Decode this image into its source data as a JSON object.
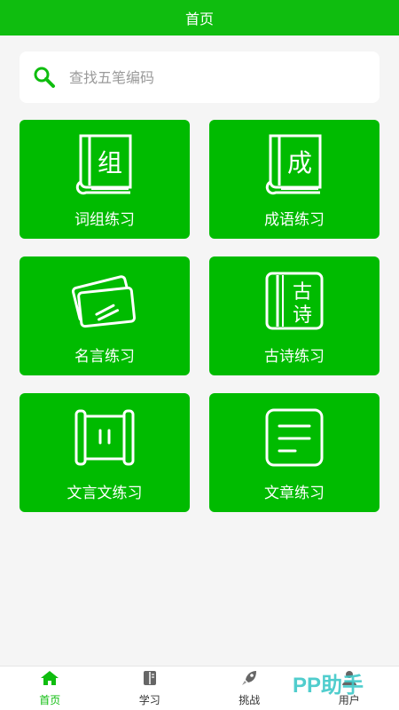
{
  "header": {
    "title": "首页"
  },
  "search": {
    "placeholder": "查找五笔编码"
  },
  "cards": [
    {
      "label": "词组练习",
      "icon": "book-icon",
      "glyph": "组"
    },
    {
      "label": "成语练习",
      "icon": "book-icon",
      "glyph": "成"
    },
    {
      "label": "名言练习",
      "icon": "cards-icon"
    },
    {
      "label": "古诗练习",
      "icon": "poem-scroll-icon",
      "glyph1": "古",
      "glyph2": "诗"
    },
    {
      "label": "文言文练习",
      "icon": "scroll-icon"
    },
    {
      "label": "文章练习",
      "icon": "document-icon"
    }
  ],
  "tabs": [
    {
      "label": "首页",
      "icon": "home-icon",
      "active": true
    },
    {
      "label": "学习",
      "icon": "notebook-icon",
      "active": false
    },
    {
      "label": "挑战",
      "icon": "rocket-icon",
      "active": false
    },
    {
      "label": "用户",
      "icon": "user-icon",
      "active": false
    }
  ],
  "watermark": {
    "text": "PP助手"
  },
  "colors": {
    "primary": "#0fbd0f",
    "card": "#00bb00",
    "background": "#f5f5f5"
  }
}
